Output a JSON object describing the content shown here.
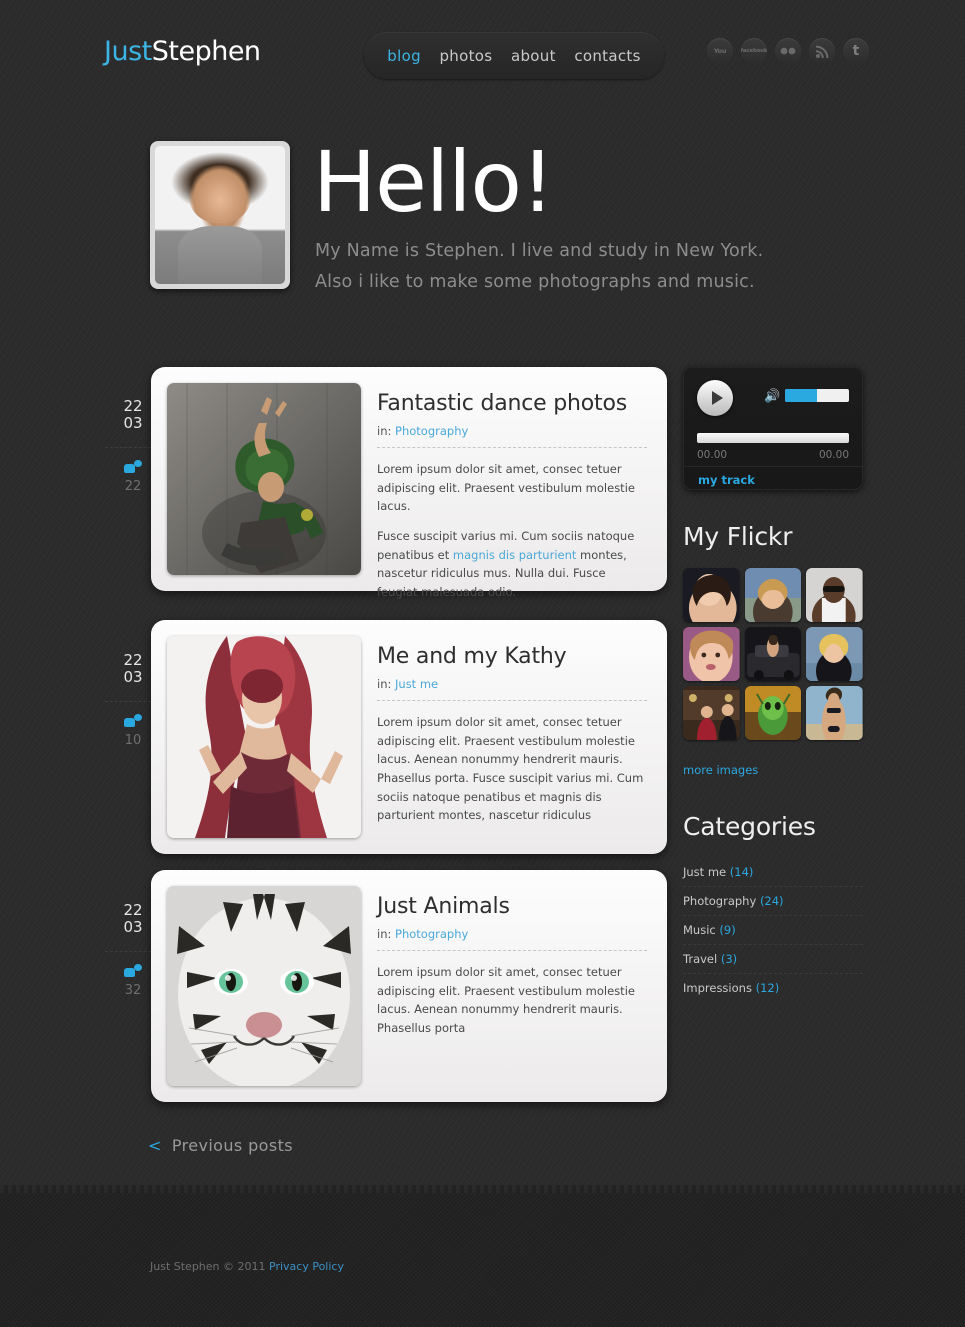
{
  "site": {
    "logo_first": "Just",
    "logo_second": "Stephen"
  },
  "nav": {
    "items": [
      {
        "label": "blog",
        "active": true
      },
      {
        "label": "photos",
        "active": false
      },
      {
        "label": "about",
        "active": false
      },
      {
        "label": "contacts",
        "active": false
      }
    ]
  },
  "social": {
    "items": [
      {
        "name": "youtube-icon",
        "glyph": "You"
      },
      {
        "name": "facebook-icon",
        "glyph": "facebook"
      },
      {
        "name": "flickr-icon",
        "glyph": "••"
      },
      {
        "name": "rss-icon",
        "glyph": ""
      },
      {
        "name": "twitter-icon",
        "glyph": "t"
      }
    ]
  },
  "hero": {
    "title": "Hello!",
    "line1": "My Name is Stephen. I live and study in New York.",
    "line2": "Also i like to make some photographs and music."
  },
  "posts": [
    {
      "day": "22",
      "month": "03",
      "comments": "22",
      "title": "Fantastic dance photos",
      "cat_prefix": "in:",
      "category": "Photography",
      "para1": "Lorem ipsum dolor sit amet, consec tetuer adipiscing elit. Praesent vestibulum molestie lacus.",
      "para2_a": "Fusce suscipit varius mi. Cum sociis natoque penatibus et ",
      "para2_link": "magnis dis parturient",
      "para2_b": " montes, nascetur ridiculus mus. Nulla dui. Fusce feugiat malesuada odio."
    },
    {
      "day": "22",
      "month": "03",
      "comments": "10",
      "title": "Me and my Kathy",
      "cat_prefix": "in:",
      "category": "Just me",
      "para1": "Lorem ipsum dolor sit amet, consec tetuer adipiscing elit. Praesent vestibulum molestie lacus. Aenean nonummy hendrerit mauris. Phasellus porta. Fusce suscipit varius mi. Cum sociis natoque penatibus et magnis dis parturient montes, nascetur ridiculus",
      "para2_a": "",
      "para2_link": "",
      "para2_b": ""
    },
    {
      "day": "22",
      "month": "03",
      "comments": "32",
      "title": "Just Animals",
      "cat_prefix": "in:",
      "category": "Photography",
      "para1": "Lorem ipsum dolor sit amet, consec tetuer adipiscing elit. Praesent vestibulum molestie lacus. Aenean nonummy hendrerit mauris. Phasellus porta",
      "para2_a": "",
      "para2_link": "",
      "para2_b": ""
    }
  ],
  "pagination": {
    "chevron": "<",
    "previous_label": "Previous posts"
  },
  "player": {
    "volume_percent": 50,
    "time_start": "00.00",
    "time_end": "00.00",
    "track_label": "my track",
    "volume_icon": "volume-icon",
    "play_icon": "play-icon"
  },
  "flickr": {
    "heading": "My Flickr",
    "more_label": "more images",
    "thumbs": [
      {
        "name": "flickr-thumb-1"
      },
      {
        "name": "flickr-thumb-2"
      },
      {
        "name": "flickr-thumb-3"
      },
      {
        "name": "flickr-thumb-4"
      },
      {
        "name": "flickr-thumb-5"
      },
      {
        "name": "flickr-thumb-6"
      },
      {
        "name": "flickr-thumb-7"
      },
      {
        "name": "flickr-thumb-8"
      },
      {
        "name": "flickr-thumb-9"
      }
    ]
  },
  "categories": {
    "heading": "Categories",
    "items": [
      {
        "label": "Just me",
        "count": "(14)"
      },
      {
        "label": "Photography",
        "count": "(24)"
      },
      {
        "label": "Music",
        "count": "(9)"
      },
      {
        "label": "Travel",
        "count": "(3)"
      },
      {
        "label": "Impressions",
        "count": "(12)"
      }
    ]
  },
  "footer": {
    "copyright": "Just Stephen © 2011 ",
    "privacy_label": "Privacy Policy"
  },
  "colors": {
    "accent": "#2aa8e0",
    "logo_accent": "#3cb4e5",
    "background": "#2a2a2a",
    "card": "#fdfdfd"
  }
}
